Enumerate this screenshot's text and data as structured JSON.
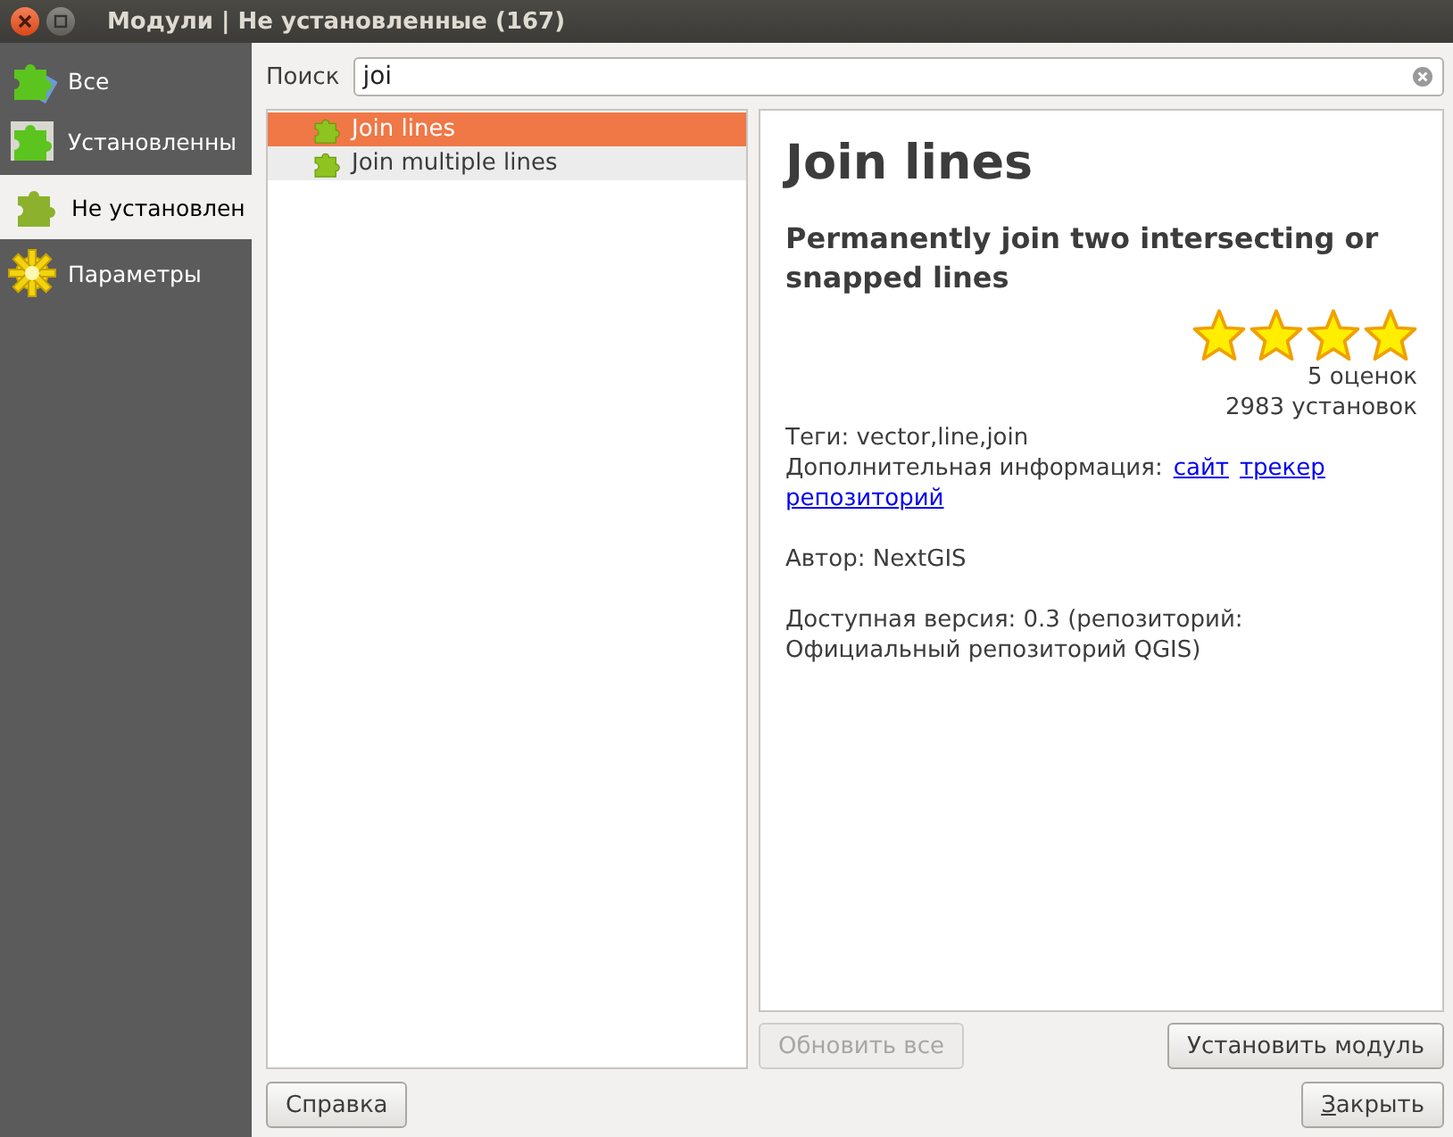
{
  "window": {
    "title": "Модули | Не установленные (167)"
  },
  "sidebar": {
    "items": [
      {
        "label": "Все",
        "kind": "all",
        "selected": false
      },
      {
        "label": "Установленны",
        "kind": "installed",
        "selected": false
      },
      {
        "label": "Не установлен",
        "kind": "notinstalled",
        "selected": true
      },
      {
        "label": "Параметры",
        "kind": "settings",
        "selected": false
      }
    ]
  },
  "search": {
    "label": "Поиск",
    "value": "joi"
  },
  "plugins": [
    {
      "name": "Join lines",
      "selected": true,
      "hovered": false
    },
    {
      "name": "Join multiple lines",
      "selected": false,
      "hovered": true
    }
  ],
  "details": {
    "title": "Join lines",
    "description": "Permanently join two intersecting or snapped lines",
    "stars": 4,
    "ratings": "5 оценок",
    "installs": "2983 установок",
    "tags": "Теги: vector,line,join",
    "more_info_label": "Дополнительная информация:",
    "links": [
      "сайт",
      "трекер",
      "репозиторий"
    ],
    "author": "Автор: NextGIS",
    "version": "Доступная версия: 0.3 (репозиторий: Официальный репозиторий QGIS)"
  },
  "buttons": [
    {
      "label": "Обновить все",
      "disabled": true
    },
    {
      "label": "Установить модуль",
      "disabled": false
    }
  ],
  "footer": {
    "help": "Справка",
    "close": "Закрыть",
    "close_mnemonic": true
  }
}
